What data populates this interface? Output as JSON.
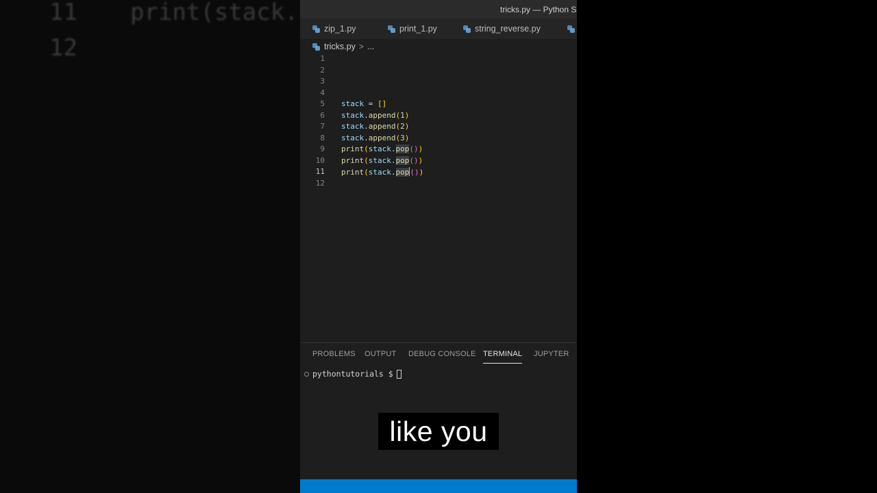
{
  "window_title": "tricks.py — Python Sh",
  "tabs": [
    "zip_1.py",
    "print_1.py",
    "string_reverse.py"
  ],
  "breadcrumb": {
    "file": "tricks.py",
    "sep": ">",
    "more": "..."
  },
  "line_numbers": [
    "1",
    "2",
    "3",
    "4",
    "5",
    "6",
    "7",
    "8",
    "9",
    "10",
    "11",
    "12"
  ],
  "code": {
    "l5": {
      "var": "stack",
      "rest": " = ",
      "brackets": "[]"
    },
    "l6": {
      "var": "stack",
      "method": ".append",
      "open": "(",
      "arg": "1",
      "close": ")"
    },
    "l7": {
      "var": "stack",
      "method": ".append",
      "open": "(",
      "arg": "2",
      "close": ")"
    },
    "l8": {
      "var": "stack",
      "method": ".append",
      "open": "(",
      "arg": "3",
      "close": ")"
    },
    "pop_line": {
      "fn": "print",
      "open": "(",
      "var": "stack",
      "dot": ".",
      "method": "pop",
      "inner": "()",
      "close": ")"
    }
  },
  "panel_tabs": [
    "PROBLEMS",
    "OUTPUT",
    "DEBUG CONSOLE",
    "TERMINAL",
    "JUPYTER"
  ],
  "active_panel_tab": "TERMINAL",
  "terminal_prompt": "pythontutorials $",
  "caption": "like you",
  "background_zoom": {
    "line11_num": "11",
    "line11_code": "print(stack.",
    "line12_num": "12"
  },
  "colors": {
    "status_bar": "#007acc",
    "editor_bg": "#1e1e1e",
    "variable": "#9cdcfe",
    "function": "#dcdcaa",
    "bracket_outer": "#ffd700",
    "bracket_inner": "#da70d6"
  }
}
